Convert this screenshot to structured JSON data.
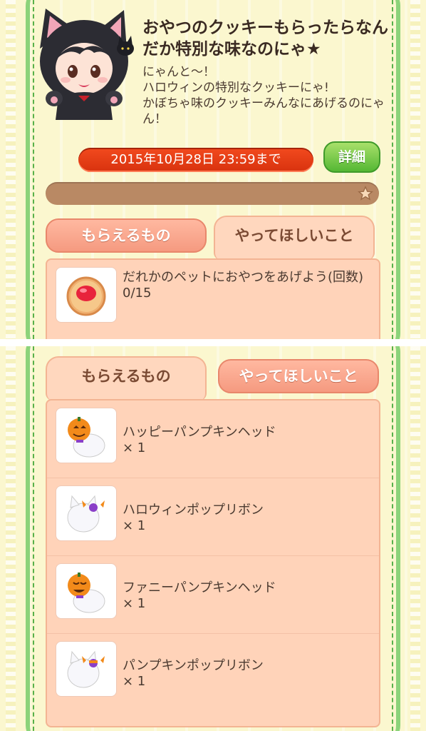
{
  "top_panel": {
    "title": "おやつのクッキーもらったらなんだか特別な味なのにゃ★",
    "description": "にゃんと〜！\nハロウィンの特別なクッキーにゃ!\nかぼちゃ味のクッキーみんなにあげるのにゃん！",
    "deadline": "2015年10月28日 23:59まで",
    "details_label": "詳細",
    "progress_fraction": 0,
    "tabs": {
      "rewards_label": "もらえるもの",
      "tasks_label": "やってほしいこと",
      "active": "tasks"
    },
    "task": {
      "icon": "jam-cookie-icon",
      "text": "だれかのペットにおやつをあげよう(回数)",
      "progress": "0/15"
    }
  },
  "bottom_panel": {
    "tabs": {
      "rewards_label": "もらえるもの",
      "tasks_label": "やってほしいこと",
      "active": "rewards"
    },
    "rewards": [
      {
        "icon": "pumpkin-head-cat-icon",
        "name": "ハッピーパンプキンヘッド",
        "qty": "× 1"
      },
      {
        "icon": "ribbon-cat-icon",
        "name": "ハロウィンポップリボン",
        "qty": "× 1"
      },
      {
        "icon": "pumpkin-head-cat-icon",
        "name": "ファニーパンプキンヘッド",
        "qty": "× 1"
      },
      {
        "icon": "ribbon-cat-icon",
        "name": "パンプキンポップリボン",
        "qty": "× 1"
      }
    ]
  },
  "colors": {
    "background": "#fbf7cf",
    "frame_green": "#8cd37a",
    "deadline_red": "#e03a14",
    "details_green": "#55b834",
    "panel_peach": "#ffd3b9"
  }
}
